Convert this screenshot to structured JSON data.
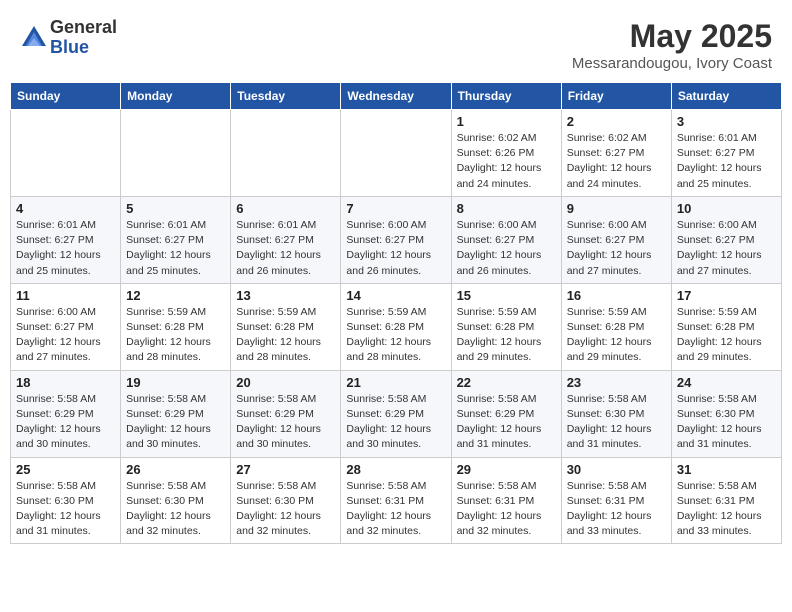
{
  "header": {
    "logo_general": "General",
    "logo_blue": "Blue",
    "month_year": "May 2025",
    "location": "Messarandougou, Ivory Coast"
  },
  "days_of_week": [
    "Sunday",
    "Monday",
    "Tuesday",
    "Wednesday",
    "Thursday",
    "Friday",
    "Saturday"
  ],
  "weeks": [
    [
      {
        "num": "",
        "info": ""
      },
      {
        "num": "",
        "info": ""
      },
      {
        "num": "",
        "info": ""
      },
      {
        "num": "",
        "info": ""
      },
      {
        "num": "1",
        "info": "Sunrise: 6:02 AM\nSunset: 6:26 PM\nDaylight: 12 hours\nand 24 minutes."
      },
      {
        "num": "2",
        "info": "Sunrise: 6:02 AM\nSunset: 6:27 PM\nDaylight: 12 hours\nand 24 minutes."
      },
      {
        "num": "3",
        "info": "Sunrise: 6:01 AM\nSunset: 6:27 PM\nDaylight: 12 hours\nand 25 minutes."
      }
    ],
    [
      {
        "num": "4",
        "info": "Sunrise: 6:01 AM\nSunset: 6:27 PM\nDaylight: 12 hours\nand 25 minutes."
      },
      {
        "num": "5",
        "info": "Sunrise: 6:01 AM\nSunset: 6:27 PM\nDaylight: 12 hours\nand 25 minutes."
      },
      {
        "num": "6",
        "info": "Sunrise: 6:01 AM\nSunset: 6:27 PM\nDaylight: 12 hours\nand 26 minutes."
      },
      {
        "num": "7",
        "info": "Sunrise: 6:00 AM\nSunset: 6:27 PM\nDaylight: 12 hours\nand 26 minutes."
      },
      {
        "num": "8",
        "info": "Sunrise: 6:00 AM\nSunset: 6:27 PM\nDaylight: 12 hours\nand 26 minutes."
      },
      {
        "num": "9",
        "info": "Sunrise: 6:00 AM\nSunset: 6:27 PM\nDaylight: 12 hours\nand 27 minutes."
      },
      {
        "num": "10",
        "info": "Sunrise: 6:00 AM\nSunset: 6:27 PM\nDaylight: 12 hours\nand 27 minutes."
      }
    ],
    [
      {
        "num": "11",
        "info": "Sunrise: 6:00 AM\nSunset: 6:27 PM\nDaylight: 12 hours\nand 27 minutes."
      },
      {
        "num": "12",
        "info": "Sunrise: 5:59 AM\nSunset: 6:28 PM\nDaylight: 12 hours\nand 28 minutes."
      },
      {
        "num": "13",
        "info": "Sunrise: 5:59 AM\nSunset: 6:28 PM\nDaylight: 12 hours\nand 28 minutes."
      },
      {
        "num": "14",
        "info": "Sunrise: 5:59 AM\nSunset: 6:28 PM\nDaylight: 12 hours\nand 28 minutes."
      },
      {
        "num": "15",
        "info": "Sunrise: 5:59 AM\nSunset: 6:28 PM\nDaylight: 12 hours\nand 29 minutes."
      },
      {
        "num": "16",
        "info": "Sunrise: 5:59 AM\nSunset: 6:28 PM\nDaylight: 12 hours\nand 29 minutes."
      },
      {
        "num": "17",
        "info": "Sunrise: 5:59 AM\nSunset: 6:28 PM\nDaylight: 12 hours\nand 29 minutes."
      }
    ],
    [
      {
        "num": "18",
        "info": "Sunrise: 5:58 AM\nSunset: 6:29 PM\nDaylight: 12 hours\nand 30 minutes."
      },
      {
        "num": "19",
        "info": "Sunrise: 5:58 AM\nSunset: 6:29 PM\nDaylight: 12 hours\nand 30 minutes."
      },
      {
        "num": "20",
        "info": "Sunrise: 5:58 AM\nSunset: 6:29 PM\nDaylight: 12 hours\nand 30 minutes."
      },
      {
        "num": "21",
        "info": "Sunrise: 5:58 AM\nSunset: 6:29 PM\nDaylight: 12 hours\nand 30 minutes."
      },
      {
        "num": "22",
        "info": "Sunrise: 5:58 AM\nSunset: 6:29 PM\nDaylight: 12 hours\nand 31 minutes."
      },
      {
        "num": "23",
        "info": "Sunrise: 5:58 AM\nSunset: 6:30 PM\nDaylight: 12 hours\nand 31 minutes."
      },
      {
        "num": "24",
        "info": "Sunrise: 5:58 AM\nSunset: 6:30 PM\nDaylight: 12 hours\nand 31 minutes."
      }
    ],
    [
      {
        "num": "25",
        "info": "Sunrise: 5:58 AM\nSunset: 6:30 PM\nDaylight: 12 hours\nand 31 minutes."
      },
      {
        "num": "26",
        "info": "Sunrise: 5:58 AM\nSunset: 6:30 PM\nDaylight: 12 hours\nand 32 minutes."
      },
      {
        "num": "27",
        "info": "Sunrise: 5:58 AM\nSunset: 6:30 PM\nDaylight: 12 hours\nand 32 minutes."
      },
      {
        "num": "28",
        "info": "Sunrise: 5:58 AM\nSunset: 6:31 PM\nDaylight: 12 hours\nand 32 minutes."
      },
      {
        "num": "29",
        "info": "Sunrise: 5:58 AM\nSunset: 6:31 PM\nDaylight: 12 hours\nand 32 minutes."
      },
      {
        "num": "30",
        "info": "Sunrise: 5:58 AM\nSunset: 6:31 PM\nDaylight: 12 hours\nand 33 minutes."
      },
      {
        "num": "31",
        "info": "Sunrise: 5:58 AM\nSunset: 6:31 PM\nDaylight: 12 hours\nand 33 minutes."
      }
    ]
  ]
}
